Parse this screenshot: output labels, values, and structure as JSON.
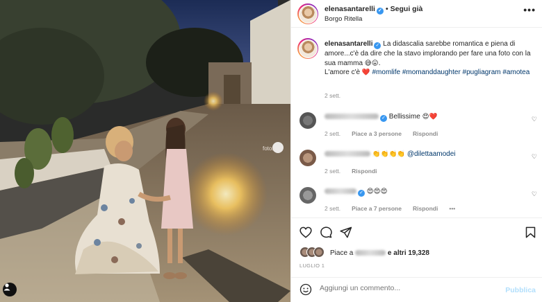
{
  "post": {
    "username": "elenasantarelli",
    "location": "Borgo Ritella",
    "follow_label": "Segui già",
    "more_label": "•••"
  },
  "caption": {
    "username": "elenasantarelli",
    "text": "La didascalia sarebbe romantica e piena di amore...c'è da dire che la stavo implorando per fare una foto con la sua mamma",
    "emojis": "😅😛.",
    "line2_text": "L'amore c'è",
    "line2_emoji": "❤️",
    "hashtags": "#momlife #momanddaughter #pugliagram #amotea",
    "time": "2 sett."
  },
  "comments": [
    {
      "text": "Bellissime",
      "emojis": "😍❤️",
      "time": "2 sett.",
      "likes": "Piace a 3 persone",
      "reply": "Rispondi"
    },
    {
      "text": "@dilettaamodei",
      "emojis": "👏👏👏👏",
      "time": "2 sett.",
      "likes": "",
      "reply": "Rispondi"
    },
    {
      "text": "",
      "emojis": "😍😍😍",
      "time": "2 sett.",
      "likes": "Piace a 7 persone",
      "reply": "Rispondi",
      "more": "•••"
    }
  ],
  "likes": {
    "prefix": "Piace a",
    "suffix": "e altri 19,328"
  },
  "date": "LUGLIO 1",
  "add_comment": {
    "placeholder": "Aggiungi un commento...",
    "publish_label": "Pubblica"
  },
  "photo": {
    "tag_text": "fotos"
  },
  "colors": {
    "link_blue": "#00376b",
    "verified_blue": "#3897f0",
    "publish_disabled": "#b2dffc",
    "muted": "#8e8e8e"
  }
}
